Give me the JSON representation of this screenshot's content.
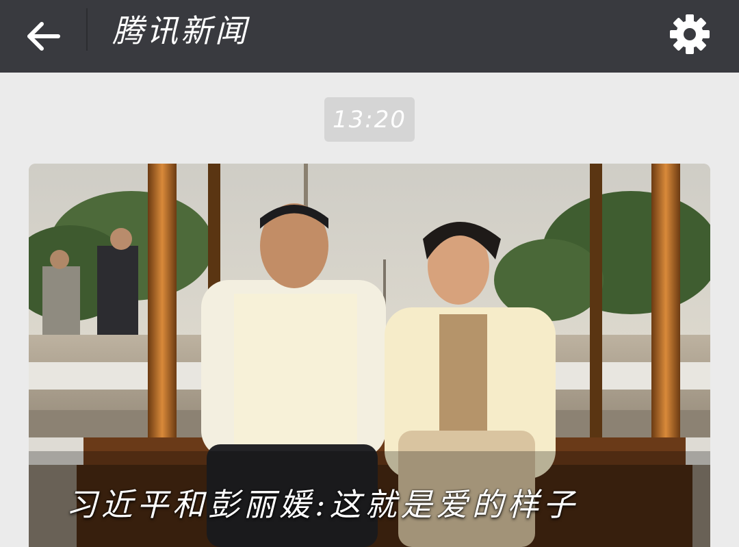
{
  "header": {
    "title": "腾讯新闻",
    "back_icon": "arrow-left-icon",
    "settings_icon": "gear-icon",
    "background": "#393a3f"
  },
  "chat": {
    "timestamp": "13:20",
    "background": "#ebebeb"
  },
  "news_card": {
    "caption": "习近平和彭丽媛:这就是爱的样子",
    "image_alt": "photo of two people sitting on an ornate wooden swing outdoors"
  }
}
